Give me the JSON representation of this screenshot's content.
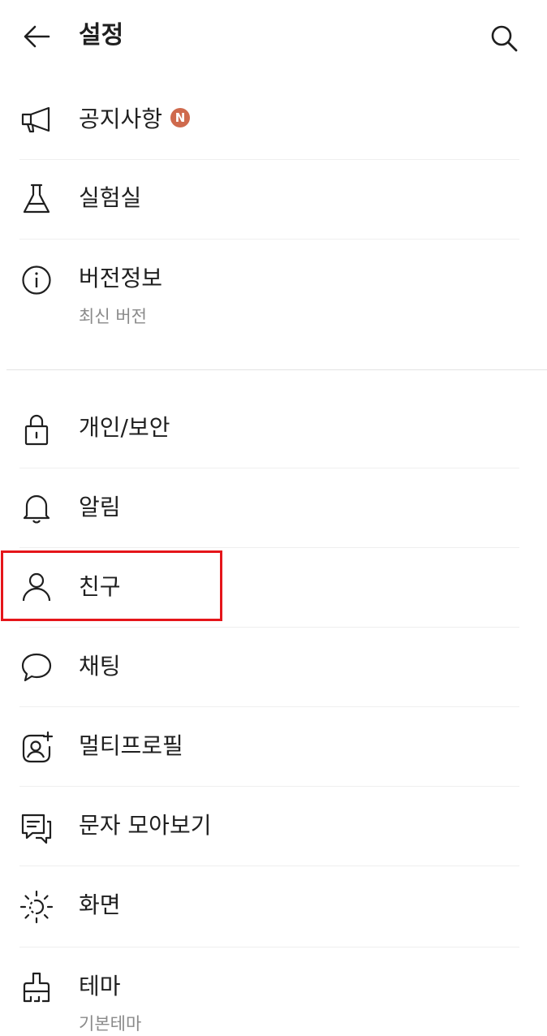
{
  "header": {
    "title": "설정"
  },
  "items": [
    {
      "id": "notice",
      "label": "공지사항",
      "badge": "N"
    },
    {
      "id": "lab",
      "label": "실험실"
    },
    {
      "id": "version",
      "label": "버전정보",
      "sub": "최신 버전"
    },
    {
      "id": "privacy",
      "label": "개인/보안"
    },
    {
      "id": "alarm",
      "label": "알림"
    },
    {
      "id": "friends",
      "label": "친구"
    },
    {
      "id": "chat",
      "label": "채팅"
    },
    {
      "id": "multiprofile",
      "label": "멀티프로필"
    },
    {
      "id": "sms",
      "label": "문자 모아보기"
    },
    {
      "id": "display",
      "label": "화면"
    },
    {
      "id": "theme",
      "label": "테마",
      "sub": "기본테마"
    }
  ],
  "icons": {
    "notice": "megaphone-icon",
    "lab": "flask-icon",
    "version": "info-icon",
    "privacy": "lock-icon",
    "alarm": "bell-icon",
    "friends": "person-icon",
    "chat": "chat-bubble-icon",
    "multiprofile": "add-profile-icon",
    "sms": "message-icon",
    "display": "brightness-icon",
    "theme": "brush-icon"
  },
  "colors": {
    "badge": "#cf6a4d",
    "highlight": "#e5151a"
  }
}
